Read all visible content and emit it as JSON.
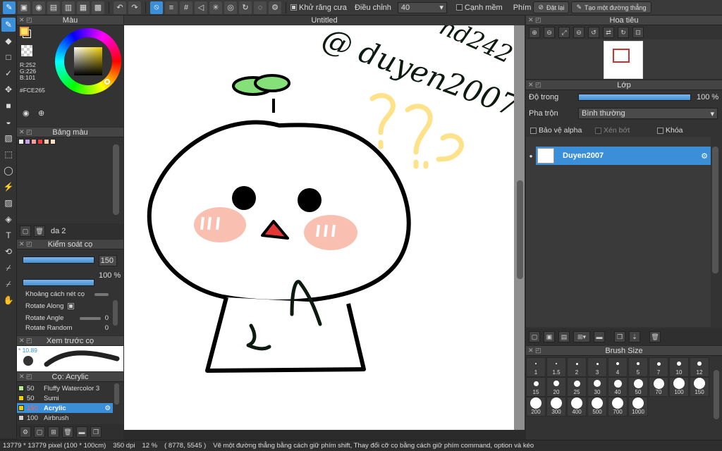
{
  "toolbar": {
    "antialias_label": "Khử răng cưa",
    "adjust_label": "Điều chỉnh",
    "adjust_value": "40",
    "edge_label": "Cạnh mềm",
    "key_label": "Phím",
    "reset_label": "Đặt lại",
    "line_label": "Tạo một đường thẳng"
  },
  "document_title": "Untitled",
  "color_panel": {
    "title": "Màu",
    "r": "R:252",
    "g": "G:226",
    "b": "B:101",
    "hex": "#FCE265",
    "fg_color": "#FCE265",
    "bg_color": "#E8E8F0"
  },
  "palette_panel": {
    "title": "Bảng màu",
    "layer_name": "da 2",
    "swatches": [
      "#f0f0f0",
      "#c8a0e8",
      "#f0a0a0",
      "#f04040",
      "#f8c8a8",
      "#f8e0c8"
    ]
  },
  "brush_control": {
    "title": "Kiểm soát cọ",
    "size_value": "150",
    "opacity_value": "100 %",
    "size_fill": 1.0,
    "opacity_fill": 1.0,
    "rows": [
      {
        "label": "Khoảng cách nét cọ"
      },
      {
        "label": "Rotate Along"
      },
      {
        "label": "Rotate Angle",
        "value": "0"
      },
      {
        "label": "Rotate Random",
        "value": "0"
      }
    ]
  },
  "preview_panel": {
    "title": "Xem trước cọ",
    "size_label": "* 10.89"
  },
  "brush_list": {
    "title": "Cọ: Acrylic",
    "items": [
      {
        "size": "50",
        "name": "Fluffy Watercolor 3",
        "color": "#b8e890"
      },
      {
        "size": "50",
        "name": "Sumi",
        "color": "#f0d000"
      },
      {
        "size": "150",
        "name": "Acrylic",
        "color": "#f0d000",
        "selected": true
      },
      {
        "size": "100",
        "name": "Airbrush",
        "color": "#d0d0d0"
      }
    ]
  },
  "navigator": {
    "title": "Hoa tiêu"
  },
  "layer_panel": {
    "title": "Lớp",
    "opacity_label": "Độ trong",
    "opacity_value": "100 %",
    "opacity_fill": 1.0,
    "blend_label": "Pha trộn",
    "blend_value": "Bình thường",
    "protect_alpha": "Bảo vệ alpha",
    "clip": "Xén bớt",
    "lock": "Khóa",
    "layer_name": "Duyen2007"
  },
  "brush_size": {
    "title": "Brush Size",
    "sizes": [
      "1",
      "1.5",
      "2",
      "3",
      "4",
      "5",
      "7",
      "10",
      "12",
      "15",
      "20",
      "25",
      "30",
      "40",
      "50",
      "70",
      "100",
      "150",
      "200",
      "300",
      "400",
      "500",
      "700",
      "1000"
    ]
  },
  "drawing": {
    "watermark": "@ duyen2007",
    "watermark2": "nd242",
    "question": "???"
  },
  "status": {
    "dims": "13779 * 13779 pixel  (100 * 100cm)",
    "dpi": "350 dpi",
    "zoom": "12 %",
    "coords": "( 8778, 5545 )",
    "hint": "Vẽ một đường thẳng bằng cách giữ phím shift, Thay đổi cỡ cọ bằng cách giữ phím command, option và kéo"
  }
}
